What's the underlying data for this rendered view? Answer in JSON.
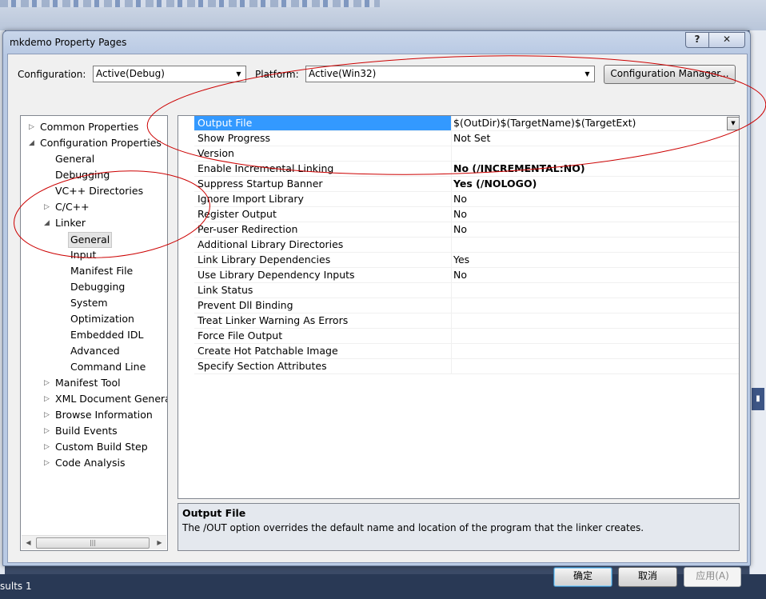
{
  "ide": {
    "status_text": "sults 1"
  },
  "dialog": {
    "title": "mkdemo Property Pages",
    "help_label": "?",
    "close_label": "✕"
  },
  "toolbar": {
    "configuration_label": "Configuration:",
    "configuration_value": "Active(Debug)",
    "platform_label": "Platform:",
    "platform_value": "Active(Win32)",
    "config_manager_label": "Configuration Manager..."
  },
  "tree": {
    "items": [
      {
        "label": "Common Properties",
        "expander": "collapsed"
      },
      {
        "label": "Configuration Properties",
        "expander": "expanded"
      },
      {
        "label": "General",
        "expander": "none"
      },
      {
        "label": "Debugging",
        "expander": "none"
      },
      {
        "label": "VC++ Directories",
        "expander": "none"
      },
      {
        "label": "C/C++",
        "expander": "collapsed"
      },
      {
        "label": "Linker",
        "expander": "expanded"
      },
      {
        "label": "General",
        "expander": "none",
        "selected": true
      },
      {
        "label": "Input",
        "expander": "none"
      },
      {
        "label": "Manifest File",
        "expander": "none"
      },
      {
        "label": "Debugging",
        "expander": "none"
      },
      {
        "label": "System",
        "expander": "none"
      },
      {
        "label": "Optimization",
        "expander": "none"
      },
      {
        "label": "Embedded IDL",
        "expander": "none"
      },
      {
        "label": "Advanced",
        "expander": "none"
      },
      {
        "label": "Command Line",
        "expander": "none"
      },
      {
        "label": "Manifest Tool",
        "expander": "collapsed"
      },
      {
        "label": "XML Document Generat",
        "expander": "collapsed"
      },
      {
        "label": "Browse Information",
        "expander": "collapsed"
      },
      {
        "label": "Build Events",
        "expander": "collapsed"
      },
      {
        "label": "Custom Build Step",
        "expander": "collapsed"
      },
      {
        "label": "Code Analysis",
        "expander": "collapsed"
      }
    ]
  },
  "grid": {
    "rows": [
      {
        "name": "Output File",
        "value": "$(OutDir)$(TargetName)$(TargetExt)",
        "bold": false,
        "selected": true
      },
      {
        "name": "Show Progress",
        "value": "Not Set",
        "bold": false
      },
      {
        "name": "Version",
        "value": "",
        "bold": false
      },
      {
        "name": "Enable Incremental Linking",
        "value": "No (/INCREMENTAL:NO)",
        "bold": true
      },
      {
        "name": "Suppress Startup Banner",
        "value": "Yes (/NOLOGO)",
        "bold": true
      },
      {
        "name": "Ignore Import Library",
        "value": "No",
        "bold": false
      },
      {
        "name": "Register Output",
        "value": "No",
        "bold": false
      },
      {
        "name": "Per-user Redirection",
        "value": "No",
        "bold": false
      },
      {
        "name": "Additional Library Directories",
        "value": "",
        "bold": false
      },
      {
        "name": "Link Library Dependencies",
        "value": "Yes",
        "bold": false
      },
      {
        "name": "Use Library Dependency Inputs",
        "value": "No",
        "bold": false
      },
      {
        "name": "Link Status",
        "value": "",
        "bold": false
      },
      {
        "name": "Prevent Dll Binding",
        "value": "",
        "bold": false
      },
      {
        "name": "Treat Linker Warning As Errors",
        "value": "",
        "bold": false
      },
      {
        "name": "Force File Output",
        "value": "",
        "bold": false
      },
      {
        "name": "Create Hot Patchable Image",
        "value": "",
        "bold": false
      },
      {
        "name": "Specify Section Attributes",
        "value": "",
        "bold": false
      }
    ]
  },
  "description": {
    "title": "Output File",
    "text": "The /OUT option overrides the default name and location of the program that the linker creates."
  },
  "buttons": {
    "ok": "确定",
    "cancel": "取消",
    "apply": "应用(A)"
  },
  "colors": {
    "selection": "#3399ff",
    "annotation": "#cc0000"
  }
}
